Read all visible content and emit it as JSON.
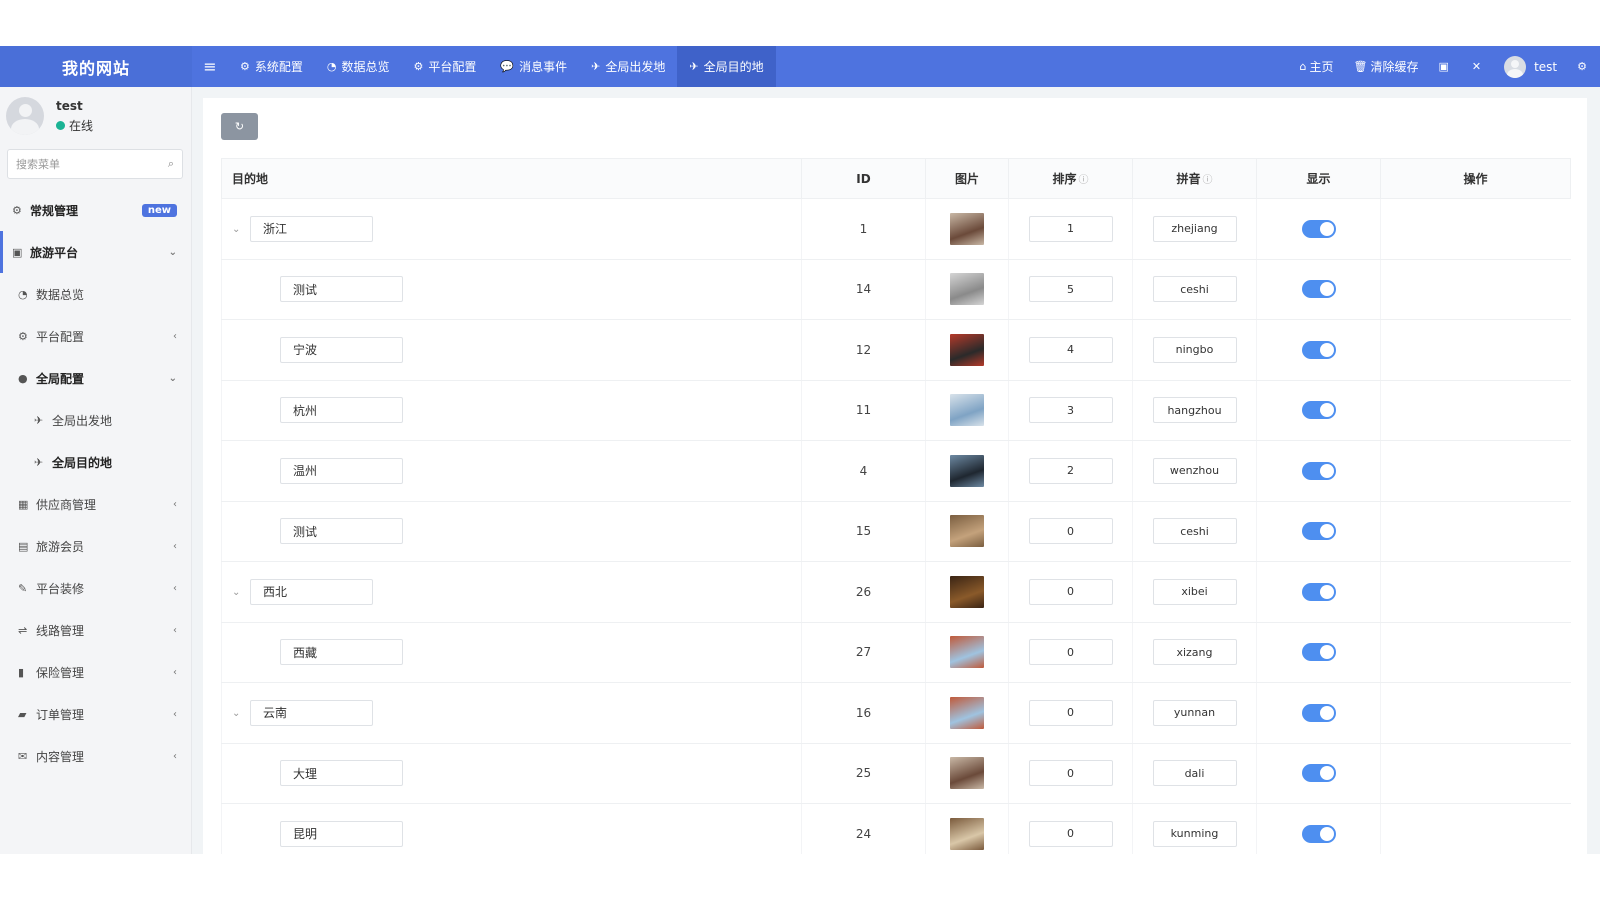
{
  "brand": "我的网站",
  "nav": [
    {
      "label": "系统配置",
      "icon": "gear-icon",
      "glyph": "⚙"
    },
    {
      "label": "数据总览",
      "icon": "dashboard-icon",
      "glyph": "◔"
    },
    {
      "label": "平台配置",
      "icon": "gear-icon",
      "glyph": "⚙"
    },
    {
      "label": "消息事件",
      "icon": "comment-icon",
      "glyph": "💬"
    },
    {
      "label": "全局出发地",
      "icon": "paper-plane-icon",
      "glyph": "✈"
    },
    {
      "label": "全局目的地",
      "icon": "paper-plane-icon",
      "glyph": "✈"
    }
  ],
  "right_nav": {
    "home": "主页",
    "clear_cache": "清除缓存",
    "username": "test"
  },
  "sidebar": {
    "username": "test",
    "status": "在线",
    "search_placeholder": "搜索菜单",
    "items": [
      {
        "label": "常规管理",
        "badge": "new"
      },
      {
        "label": "旅游平台"
      },
      {
        "label": "数据总览"
      },
      {
        "label": "平台配置"
      },
      {
        "label": "全局配置"
      },
      {
        "label": "全局出发地"
      },
      {
        "label": "全局目的地"
      },
      {
        "label": "供应商管理"
      },
      {
        "label": "旅游会员"
      },
      {
        "label": "平台装修"
      },
      {
        "label": "线路管理"
      },
      {
        "label": "保险管理"
      },
      {
        "label": "订单管理"
      },
      {
        "label": "内容管理"
      }
    ]
  },
  "table": {
    "headers": {
      "name": "目的地",
      "id": "ID",
      "image": "图片",
      "sort": "排序",
      "pinyin": "拼音",
      "show": "显示",
      "ops": "操作"
    },
    "rows": [
      {
        "level": 0,
        "name": "浙江",
        "id": "1",
        "sort": "1",
        "pinyin": "zhejiang",
        "colors": [
          "#6b4a3a",
          "#c9b8a6"
        ],
        "show": true
      },
      {
        "level": 1,
        "name": "测试",
        "id": "14",
        "sort": "5",
        "pinyin": "ceshi",
        "colors": [
          "#8a8a8a",
          "#d5d5d5"
        ],
        "show": true
      },
      {
        "level": 1,
        "name": "宁波",
        "id": "12",
        "sort": "4",
        "pinyin": "ningbo",
        "colors": [
          "#2a2a2a",
          "#b53a2a"
        ],
        "show": true
      },
      {
        "level": 1,
        "name": "杭州",
        "id": "11",
        "sort": "3",
        "pinyin": "hangzhou",
        "colors": [
          "#7fa3c4",
          "#d8e2ea"
        ],
        "show": true
      },
      {
        "level": 1,
        "name": "温州",
        "id": "4",
        "sort": "2",
        "pinyin": "wenzhou",
        "colors": [
          "#1f2730",
          "#6e8aa3"
        ],
        "show": true
      },
      {
        "level": 1,
        "name": "测试",
        "id": "15",
        "sort": "0",
        "pinyin": "ceshi",
        "colors": [
          "#c4a27c",
          "#7a5e40"
        ],
        "show": true
      },
      {
        "level": 0,
        "name": "西北",
        "id": "26",
        "sort": "0",
        "pinyin": "xibei",
        "colors": [
          "#8a5a2a",
          "#3a2414"
        ],
        "show": true
      },
      {
        "level": 1,
        "name": "西藏",
        "id": "27",
        "sort": "0",
        "pinyin": "xizang",
        "colors": [
          "#9fc3e0",
          "#c05a3a"
        ],
        "show": true
      },
      {
        "level": 0,
        "name": "云南",
        "id": "16",
        "sort": "0",
        "pinyin": "yunnan",
        "colors": [
          "#9fc3e0",
          "#c05a3a"
        ],
        "show": true
      },
      {
        "level": 1,
        "name": "大理",
        "id": "25",
        "sort": "0",
        "pinyin": "dali",
        "colors": [
          "#6b4a3a",
          "#c9b8a6"
        ],
        "show": true
      },
      {
        "level": 1,
        "name": "昆明",
        "id": "24",
        "sort": "0",
        "pinyin": "kunming",
        "colors": [
          "#d9c7a8",
          "#7a5a3c"
        ],
        "show": true
      }
    ]
  }
}
